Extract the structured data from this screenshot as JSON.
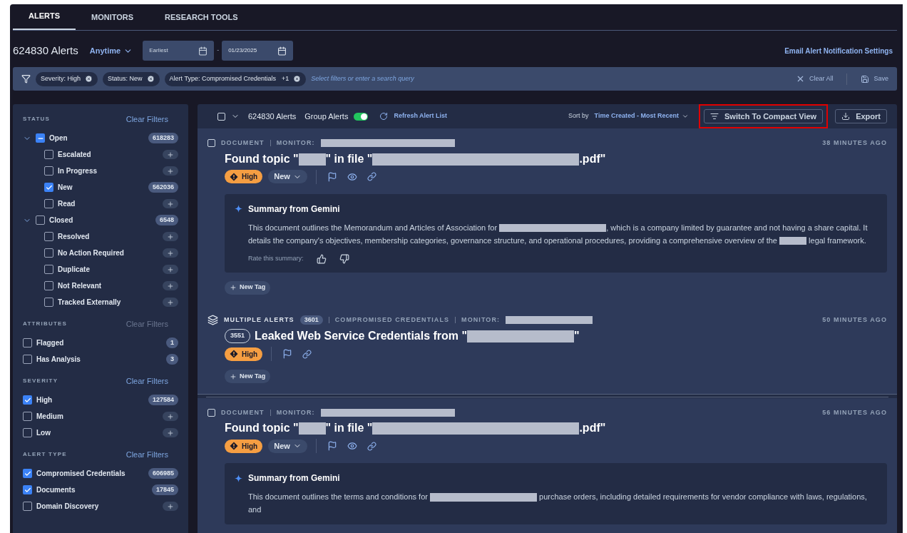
{
  "tabs": [
    {
      "label": "ALERTS",
      "selected": true
    },
    {
      "label": "MONITORS",
      "selected": false
    },
    {
      "label": "RESEARCH TOOLS",
      "selected": false
    }
  ],
  "header": {
    "count": "624830 Alerts",
    "range": "Anytime",
    "start_date": "Earliest",
    "end_date": "01/23/2025",
    "separator": "-",
    "settings_link": "Email Alert Notification Settings"
  },
  "filter_bar": {
    "chips": [
      {
        "label": "Severity: High"
      },
      {
        "label": "Status: New"
      },
      {
        "label": "Alert Type: Compromised Credentials",
        "extra": "+1"
      }
    ],
    "placeholder": "Select filters or enter a search query",
    "clear": "Clear All",
    "save": "Save"
  },
  "sidebar": [
    {
      "title": "STATUS",
      "clear": "Clear Filters",
      "disabled": false,
      "items": [
        {
          "label": "Open",
          "checked": false,
          "partial": true,
          "count": "618283",
          "expanded": true,
          "children": [
            {
              "label": "Escalated",
              "checked": false
            },
            {
              "label": "In Progress",
              "checked": false
            },
            {
              "label": "New",
              "checked": true,
              "count": "562036"
            },
            {
              "label": "Read",
              "checked": false
            }
          ]
        },
        {
          "label": "Closed",
          "checked": false,
          "partial": false,
          "count": "6548",
          "expanded": true,
          "children": [
            {
              "label": "Resolved",
              "checked": false
            },
            {
              "label": "No Action Required",
              "checked": false
            },
            {
              "label": "Duplicate",
              "checked": false
            },
            {
              "label": "Not Relevant",
              "checked": false
            },
            {
              "label": "Tracked Externally",
              "checked": false
            }
          ]
        }
      ]
    },
    {
      "title": "ATTRIBUTES",
      "clear": "Clear Filters",
      "disabled": true,
      "items": [
        {
          "label": "Flagged",
          "checked": false,
          "count": "1"
        },
        {
          "label": "Has Analysis",
          "checked": false,
          "count": "3"
        }
      ]
    },
    {
      "title": "SEVERITY",
      "clear": "Clear Filters",
      "disabled": false,
      "items": [
        {
          "label": "High",
          "checked": true,
          "count": "127584"
        },
        {
          "label": "Medium",
          "checked": false
        },
        {
          "label": "Low",
          "checked": false
        }
      ]
    },
    {
      "title": "ALERT TYPE",
      "clear": "Clear Filters",
      "disabled": false,
      "items": [
        {
          "label": "Compromised Credentials",
          "checked": true,
          "count": "606985"
        },
        {
          "label": "Documents",
          "checked": true,
          "count": "17845"
        },
        {
          "label": "Domain Discovery",
          "checked": false
        }
      ]
    }
  ],
  "list_header": {
    "select_all": false,
    "count": "624830 Alerts",
    "group_label": "Group Alerts",
    "group_on": true,
    "refresh": "Refresh Alert List",
    "sort_label": "Sort by",
    "sort_value": "Time Created - Most Recent",
    "compact": "Switch To Compact View",
    "compact_highlighted": true,
    "export": "Export"
  },
  "alerts": [
    {
      "kind": "document",
      "checked": false,
      "type": "DOCUMENT",
      "monitor": "MONITOR:",
      "time": "38 MINUTES AGO",
      "title": [
        {
          "kind": "text",
          "text": "Found topic \""
        },
        {
          "kind": "redaction"
        },
        {
          "kind": "text",
          "text": "\" in file \""
        },
        {
          "kind": "redaction"
        },
        {
          "kind": "text",
          "text": ".pdf\""
        }
      ],
      "severity": "High",
      "status": "New",
      "summary": {
        "title": "Summary from Gemini",
        "text": [
          {
            "kind": "text",
            "text": "This document outlines the Memorandum and Articles of Association for "
          },
          {
            "kind": "redaction"
          },
          {
            "kind": "text",
            "text": ", which is a company limited by guarantee and not having a share capital. It details the company's objectives, membership categories, governance structure, and operational procedures, providing a comprehensive overview of the "
          },
          {
            "kind": "redaction"
          },
          {
            "kind": "text",
            "text": " legal framework."
          }
        ],
        "rate": "Rate this summary:"
      },
      "new_tag": "New Tag"
    },
    {
      "kind": "multiple",
      "type": "MULTIPLE ALERTS",
      "group_count": "3601",
      "category": "COMPROMISED CREDENTIALS",
      "monitor": "MONITOR:",
      "time": "50 MINUTES AGO",
      "badge": "3551",
      "title": [
        {
          "kind": "text",
          "text": "Leaked Web Service Credentials from \""
        },
        {
          "kind": "redaction"
        },
        {
          "kind": "text",
          "text": "\""
        }
      ],
      "severity": "High",
      "new_tag": "New Tag"
    },
    {
      "kind": "document",
      "checked": false,
      "type": "DOCUMENT",
      "monitor": "MONITOR:",
      "time": "56 MINUTES AGO",
      "title": [
        {
          "kind": "text",
          "text": "Found topic \""
        },
        {
          "kind": "redaction"
        },
        {
          "kind": "text",
          "text": "\" in file \""
        },
        {
          "kind": "redaction"
        },
        {
          "kind": "text",
          "text": ".pdf\""
        }
      ],
      "severity": "High",
      "status": "New",
      "summary": {
        "title": "Summary from Gemini",
        "text": [
          {
            "kind": "text",
            "text": "This document outlines the terms and conditions for "
          },
          {
            "kind": "redaction"
          },
          {
            "kind": "text",
            "text": " purchase orders, including detailed requirements for vendor compliance with laws, regulations, and"
          }
        ]
      }
    }
  ]
}
